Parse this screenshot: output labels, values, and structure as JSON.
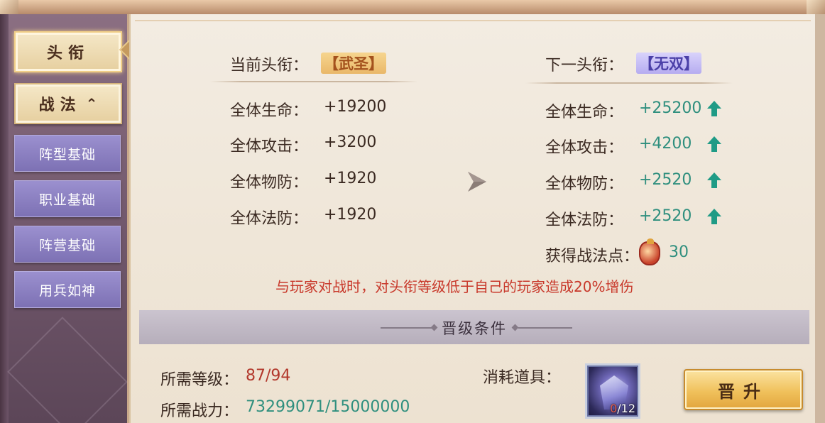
{
  "sidebar": {
    "main_tabs": [
      {
        "label": "头衔",
        "active": true
      },
      {
        "label": "战法",
        "expanded": true
      }
    ],
    "sub_tabs": [
      "阵型基础",
      "职业基础",
      "阵营基础",
      "用兵如神"
    ]
  },
  "current": {
    "label": "当前头衔：",
    "title": "【武圣】",
    "stats": [
      {
        "name": "全体生命：",
        "value": "+19200"
      },
      {
        "name": "全体攻击：",
        "value": "+3200"
      },
      {
        "name": "全体物防：",
        "value": "+1920"
      },
      {
        "name": "全体法防：",
        "value": "+1920"
      }
    ]
  },
  "next": {
    "label": "下一头衔：",
    "title": "【无双】",
    "stats": [
      {
        "name": "全体生命：",
        "value": "+25200"
      },
      {
        "name": "全体攻击：",
        "value": "+4200"
      },
      {
        "name": "全体物防：",
        "value": "+2520"
      },
      {
        "name": "全体法防：",
        "value": "+2520"
      }
    ],
    "points_label": "获得战法点：",
    "points_value": "30"
  },
  "notice": "与玩家对战时，对头衔等级低于自己的玩家造成20%增伤",
  "conditions": {
    "title": "晋级条件",
    "level_label": "所需等级：",
    "level_value": "87/94",
    "power_label": "所需战力：",
    "power_value": "73299071/15000000",
    "item_label": "消耗道具：",
    "item_count_have": "0",
    "item_count_total": "/12"
  },
  "promote_button": "晋升",
  "colors": {
    "up_value": "#2f8f7e",
    "warning": "#c8382a",
    "button_gold": "#f0c15c",
    "subtab_purple": "#8a7fc2"
  }
}
